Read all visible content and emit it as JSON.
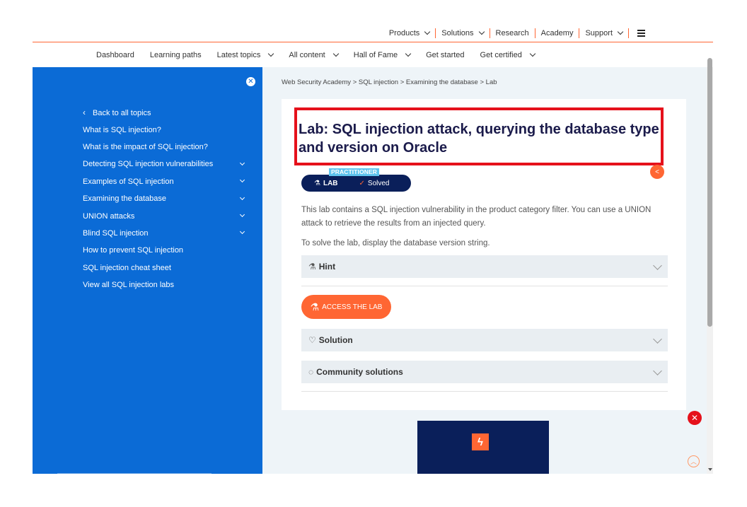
{
  "topnav": {
    "items": [
      {
        "label": "Products",
        "has_menu": true
      },
      {
        "label": "Solutions",
        "has_menu": true
      },
      {
        "label": "Research",
        "has_menu": false
      },
      {
        "label": "Academy",
        "has_menu": false
      },
      {
        "label": "Support",
        "has_menu": true
      }
    ],
    "menu_icon": "hamburger-icon"
  },
  "mainnav": {
    "items": [
      {
        "label": "Dashboard"
      },
      {
        "label": "Learning paths"
      },
      {
        "label": "Latest topics"
      },
      {
        "label": "All content"
      },
      {
        "label": "Hall of Fame"
      },
      {
        "label": "Get started"
      },
      {
        "label": "Get certified"
      }
    ]
  },
  "sidebar": {
    "close_icon": "close-icon",
    "back_label": "Back to all topics",
    "items": [
      {
        "label": "What is SQL injection?"
      },
      {
        "label": "What is the impact of SQL injection?"
      },
      {
        "label": "Detecting SQL injection vulnerabilities"
      },
      {
        "label": "Examples of SQL injection"
      },
      {
        "label": "Examining the database"
      },
      {
        "label": "UNION attacks"
      },
      {
        "label": "Blind SQL injection"
      },
      {
        "label": "How to prevent SQL injection"
      },
      {
        "label": "SQL injection cheat sheet"
      },
      {
        "label": "View all SQL injection labs"
      }
    ]
  },
  "breadcrumb": {
    "items": [
      "Web Security Academy",
      "SQL injection",
      "Examining the database",
      "Lab"
    ],
    "separator": ">"
  },
  "lab": {
    "title": "Lab: SQL injection attack, querying the database type and version on Oracle",
    "level_badge": "PRACTITIONER",
    "lab_label": "LAB",
    "status": "Solved",
    "description": "This lab contains a SQL injection vulnerability in the product category filter. You can use a UNION attack to retrieve the results from an injected query.",
    "goal": "To solve the lab, display the database version string.",
    "hint_label": "Hint",
    "access_button": "ACCESS THE LAB",
    "solution_label": "Solution",
    "community_label": "Community solutions"
  },
  "colors": {
    "accent": "#ff6633",
    "sidebar": "#0b6bd6",
    "highlight_box": "#e5111b",
    "title": "#1b1b4b",
    "pill": "#0a1f5a"
  }
}
